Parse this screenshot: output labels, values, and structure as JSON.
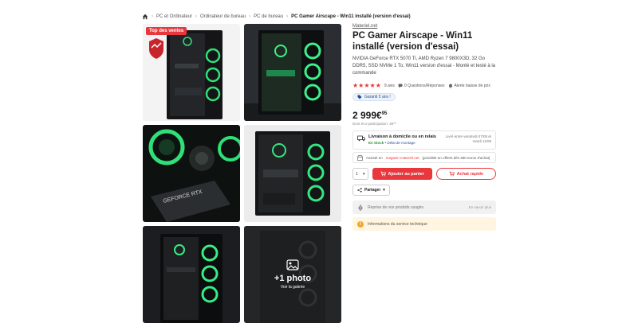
{
  "breadcrumb": {
    "items": [
      "PC et Ordinateur",
      "Ordinateur de bureau",
      "PC de bureau"
    ],
    "current": "PC Gamer Airscape - Win11 installé (version d'essai)"
  },
  "gallery": {
    "badge": "Top des ventes",
    "seal_text": "GARANTIE 5 ANS",
    "more_photos": "+1 photo",
    "see_gallery": "Voir la galerie"
  },
  "product": {
    "seller": "Materiel.net",
    "title": "PC Gamer Airscape - Win11 installé (version d'essai)",
    "specs": "NVIDIA GeForce RTX 5070 Ti, AMD Ryzen 7 9800X3D, 32 Go DDR5, SSD NVMe 1 To, Win11 version d'essai - Monté et testé à la commande",
    "rating_stars": 5,
    "reviews_count": "9 avis",
    "questions": "0 Questions/Réponses",
    "price_alert": "Alerte baisse de prix",
    "warranty": "Garanti 5 ans !",
    "price_main": "2 999€",
    "price_cents": "95",
    "price_sub": "Dont éco-participation: 4€**"
  },
  "delivery": {
    "title": "Livraison à domicile ou en relais",
    "stock": "En Stock",
    "assembly_link": "• Délai de montage",
    "date": "Livré entre vendredi 07/08 et mardi 11/08"
  },
  "assembly": {
    "prefix": "Assisté en",
    "brand": "magasin materiel.net",
    "suffix": "(possible en offerts dès 350 euros d'achat)"
  },
  "actions": {
    "qty": "1",
    "add_to_cart": "Ajouter au panier",
    "quick_buy": "Achat rapide",
    "share": "Partager"
  },
  "reprise": {
    "label": "Reprise de vos produits usagés",
    "soon": "En savoir plus"
  },
  "service": {
    "label": "Informations du service technique"
  },
  "colors": {
    "accent": "#e8383d",
    "link": "#1f4e9a",
    "stock_ok": "#2a8f3a"
  }
}
